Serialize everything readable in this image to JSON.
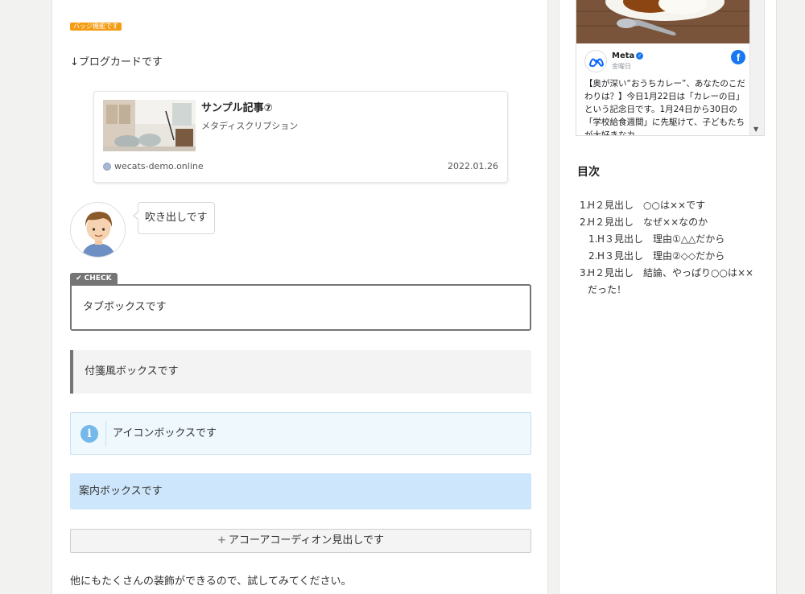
{
  "main": {
    "badge": "バッジ機能です",
    "intro": "↓ブログカードです",
    "blog_card": {
      "title": "サンプル記事⑦",
      "description": "メタディスクリプション",
      "site": "wecats-demo.online",
      "date": "2022.01.26"
    },
    "speech_bubble": "吹き出しです",
    "tab_box": {
      "label": "✔ CHECK",
      "text": "タブボックスです"
    },
    "sticky_box": "付箋風ボックスです",
    "icon_box": {
      "icon": "info-icon",
      "text": "アイコンボックスです"
    },
    "guide_box": "案内ボックスです",
    "accordion": {
      "icon": "plus-icon",
      "label": "アコーアコーディオン見出しです"
    },
    "closing": "他にもたくさんの装飾ができるので、試してみてください。"
  },
  "sidebar": {
    "facebook": {
      "page_name": "Meta",
      "day": "金曜日",
      "text": "【奥が深い“おうちカレー”、あなたのこだわりは？】今日1月22日は「カレーの日」という記念日です。1月24日から30日の「学校給食週間」に先駆けて、子どもたちが大好きなカ"
    },
    "toc": {
      "title": "目次",
      "items": [
        {
          "num": "1.",
          "text": "H２見出し　○○は××です"
        },
        {
          "num": "2.",
          "text": "H２見出し　なぜ××なのか"
        },
        {
          "num": "1.",
          "text": "H３見出し　理由①△△だから",
          "sub": true
        },
        {
          "num": "2.",
          "text": "H３見出し　理由②◇◇だから",
          "sub": true
        },
        {
          "num": "3.",
          "text": "H２見出し　結論、やっぱり○○は××だった！"
        }
      ]
    }
  },
  "colors": {
    "badge": "#f39c12",
    "tab_border": "#757575",
    "icon_box_bg": "#eff8fd",
    "guide_box_bg": "#cde6fb",
    "facebook_blue": "#1877f2"
  }
}
